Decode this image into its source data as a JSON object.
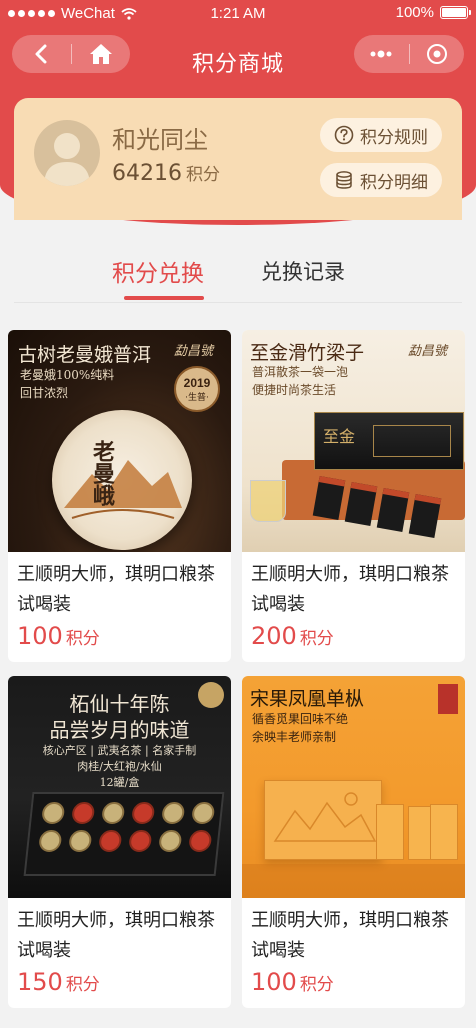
{
  "status_bar": {
    "carrier": "WeChat",
    "time": "1:21 AM",
    "battery": "100%"
  },
  "nav": {
    "title": "积分商城"
  },
  "user": {
    "name": "和光同尘",
    "points": "64216",
    "points_unit": "积分",
    "rules_label": "积分规则",
    "detail_label": "积分明细"
  },
  "tabs": [
    {
      "label": "积分兑换",
      "active": true
    },
    {
      "label": "兑换记录",
      "active": false
    }
  ],
  "colors": {
    "brand_red": "#e24b4b",
    "card_gold": "#f8dcb4"
  },
  "products": [
    {
      "image": {
        "headline": "古树老曼娥普洱",
        "sub1": "老曼娥100%纯料",
        "sub2": "回甘浓烈",
        "brand": "勐昌號",
        "badge_year": "2019",
        "badge_text": "·生普·",
        "cake_text": "老曼峨"
      },
      "title": "王顺明大师，琪明口粮茶试喝装",
      "points": "100",
      "unit": "积分"
    },
    {
      "image": {
        "headline": "至金滑竹梁子",
        "sub1": "普洱散茶一袋一泡",
        "sub2": "便捷时尚茶生活",
        "brand": "勐昌號",
        "box_text": "至金"
      },
      "title": "王顺明大师，琪明口粮茶试喝装",
      "points": "200",
      "unit": "积分"
    },
    {
      "image": {
        "headline": "柘仙十年陈",
        "headline2": "品尝岁月的味道",
        "sub1": "核心产区 | 武夷名茶 | 名家手制",
        "sub2": "肉桂/大红袍/水仙",
        "sub3": "12罐/盒",
        "brand": "柘仙"
      },
      "title": "王顺明大师，琪明口粮茶试喝装",
      "points": "150",
      "unit": "积分"
    },
    {
      "image": {
        "headline": "宋果凤凰单枞",
        "sub1": "循香觅果回味不绝",
        "sub2": "余映丰老师亲制"
      },
      "title": "王顺明大师，琪明口粮茶试喝装",
      "points": "100",
      "unit": "积分"
    }
  ]
}
